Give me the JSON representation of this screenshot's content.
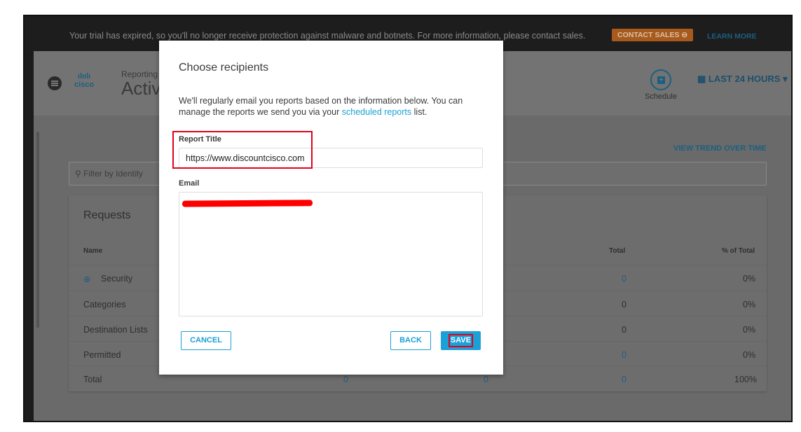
{
  "banner": {
    "text": "Your trial has expired, so you'll no longer receive protection against malware and botnets. For more information, please contact sales.",
    "contact_sales": "CONTACT SALES",
    "learn_more": "LEARN MORE"
  },
  "header": {
    "logo": "cisco",
    "breadcrumb": "Reporting",
    "title": "Activ",
    "schedule_label": "Schedule",
    "time_range": "LAST 24 HOURS"
  },
  "main": {
    "view_trend": "VIEW TREND OVER TIME",
    "filter_placeholder": "Filter by Identity",
    "card_title": "Requests",
    "columns": {
      "name": "Name",
      "total": "Total",
      "pct": "% of Total"
    },
    "rows": [
      {
        "name": "Security",
        "total": "0",
        "pct": "0%"
      },
      {
        "name": "Categories",
        "total": "0",
        "pct": "0%"
      },
      {
        "name": "Destination Lists",
        "total": "0",
        "pct": "0%"
      },
      {
        "name": "Permitted",
        "total": "0",
        "pct": "0%"
      },
      {
        "name": "Total",
        "c1": "0",
        "c2": "0",
        "total": "0",
        "pct": "100%"
      }
    ]
  },
  "modal": {
    "title": "Choose recipients",
    "description": "We'll regularly email you reports based on the information below. You can manage the reports we send you via your",
    "link": "scheduled reports",
    "description_end": "list.",
    "report_title_label": "Report Title",
    "report_title_value": "https://www.discountcisco.com",
    "email_label": "Email",
    "cancel": "CANCEL",
    "back": "BACK",
    "save": "SAVE"
  },
  "colors": {
    "accent": "#1ba0d7",
    "highlight": "#e3001b",
    "contact": "#a85a1c"
  }
}
